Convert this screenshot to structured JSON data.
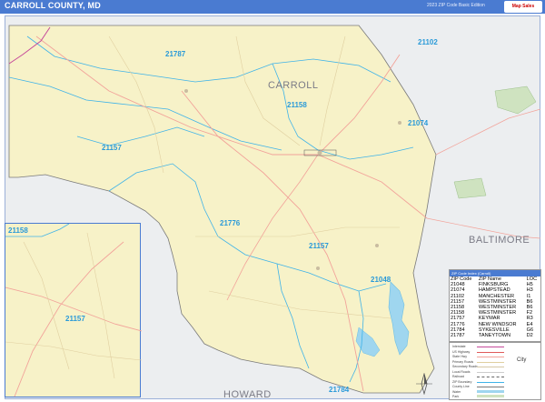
{
  "header": {
    "title": "CARROLL COUNTY, MD",
    "subtitle": "2023 ZIP Code Basic Edition",
    "logo_text": "Map Sales"
  },
  "map_labels": {
    "county": "CARROLL",
    "neighbors": [
      "BALTIMORE",
      "HOWARD"
    ],
    "zips": [
      "21102",
      "21787",
      "21158",
      "21074",
      "21157",
      "21776",
      "21157",
      "21048",
      "21784"
    ]
  },
  "inset": {
    "zips": [
      "21158",
      "21157"
    ]
  },
  "legend": {
    "title": "ZIP Code Index (Carroll)",
    "headers": [
      "ZIP Code",
      "ZIP Name",
      "LOC"
    ],
    "rows": [
      [
        "21048",
        "FINKSBURG",
        "H5"
      ],
      [
        "21074",
        "HAMPSTEAD",
        "H3"
      ],
      [
        "21102",
        "MANCHESTER",
        "I1"
      ],
      [
        "21157",
        "WESTMINSTER",
        "B6"
      ],
      [
        "21158",
        "WESTMINSTER",
        "B6"
      ],
      [
        "21158",
        "WESTMINSTER",
        "F2"
      ],
      [
        "21757",
        "KEYMAR",
        "R3"
      ],
      [
        "21776",
        "NEW WINDSOR",
        "E4"
      ],
      [
        "21784",
        "SYKESVILLE",
        "G6"
      ],
      [
        "21787",
        "TANEYTOWN",
        "D2"
      ]
    ]
  },
  "key": {
    "city_label": "City",
    "rows": [
      "Interstate",
      "US Highway",
      "State Hwy",
      "Primary Roads",
      "Secondary Roads",
      "Local Roads",
      "Railroad",
      "ZIP Boundary",
      "County Line",
      "Water",
      "Park"
    ]
  },
  "colors": {
    "header": "#4a7bd1",
    "county_fill": "#f7f2c8",
    "outside_fill": "#eceef0",
    "zip_label": "#2a9ad8",
    "zip_boundary": "#3fb3e8",
    "roads": "#f2a39a"
  }
}
